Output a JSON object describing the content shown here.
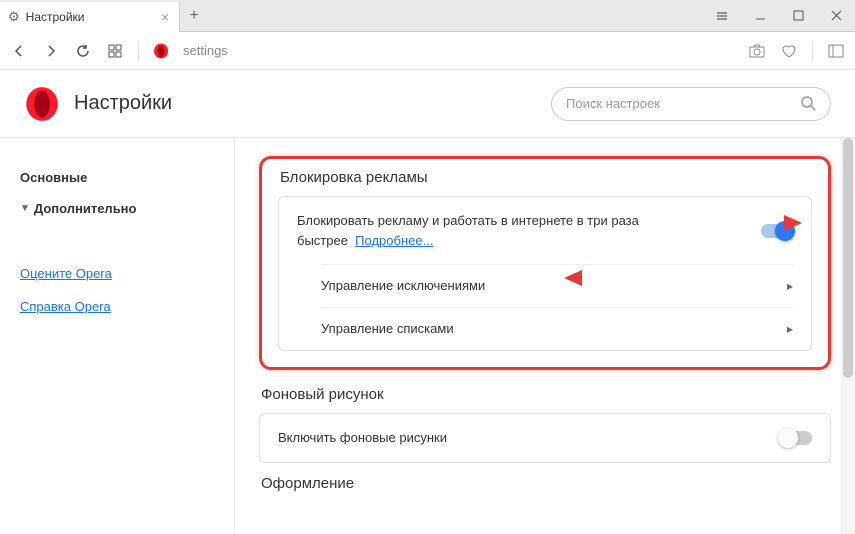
{
  "tab": {
    "title": "Настройки"
  },
  "addr": {
    "text": "settings"
  },
  "header": {
    "title": "Настройки",
    "search_placeholder": "Поиск настроек"
  },
  "sidebar": {
    "basic": "Основные",
    "advanced": "Дополнительно",
    "rate": "Оцените Opera",
    "help": "Справка Opera"
  },
  "adblock": {
    "title": "Блокировка рекламы",
    "desc": "Блокировать рекламу и работать в интернете в три раза быстрее",
    "more": "Подробнее...",
    "exceptions": "Управление исключениями",
    "lists": "Управление списками"
  },
  "wallpaper": {
    "title": "Фоновый рисунок",
    "enable": "Включить фоновые рисунки"
  },
  "theme": {
    "title": "Оформление"
  }
}
